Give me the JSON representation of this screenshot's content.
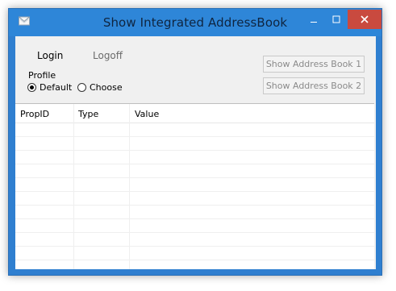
{
  "window": {
    "title": "Show Integrated AddressBook"
  },
  "toolbar": {
    "login_label": "Login",
    "logoff_label": "Logoff"
  },
  "profile": {
    "label": "Profile",
    "options": [
      {
        "label": "Default",
        "selected": true
      },
      {
        "label": "Choose",
        "selected": false
      }
    ]
  },
  "actions": {
    "show_address_book_1": "Show Address Book 1",
    "show_address_book_2": "Show Address Book 2"
  },
  "table": {
    "columns": [
      "PropID",
      "Type",
      "Value"
    ],
    "rows": []
  },
  "colors": {
    "titlebar_bg": "#2e86d8",
    "close_bg": "#c94a3f",
    "client_bg": "#f0f0f0"
  },
  "icons": {
    "app": "envelope-icon",
    "minimize": "minimize-icon",
    "maximize": "maximize-icon",
    "close": "close-icon"
  }
}
